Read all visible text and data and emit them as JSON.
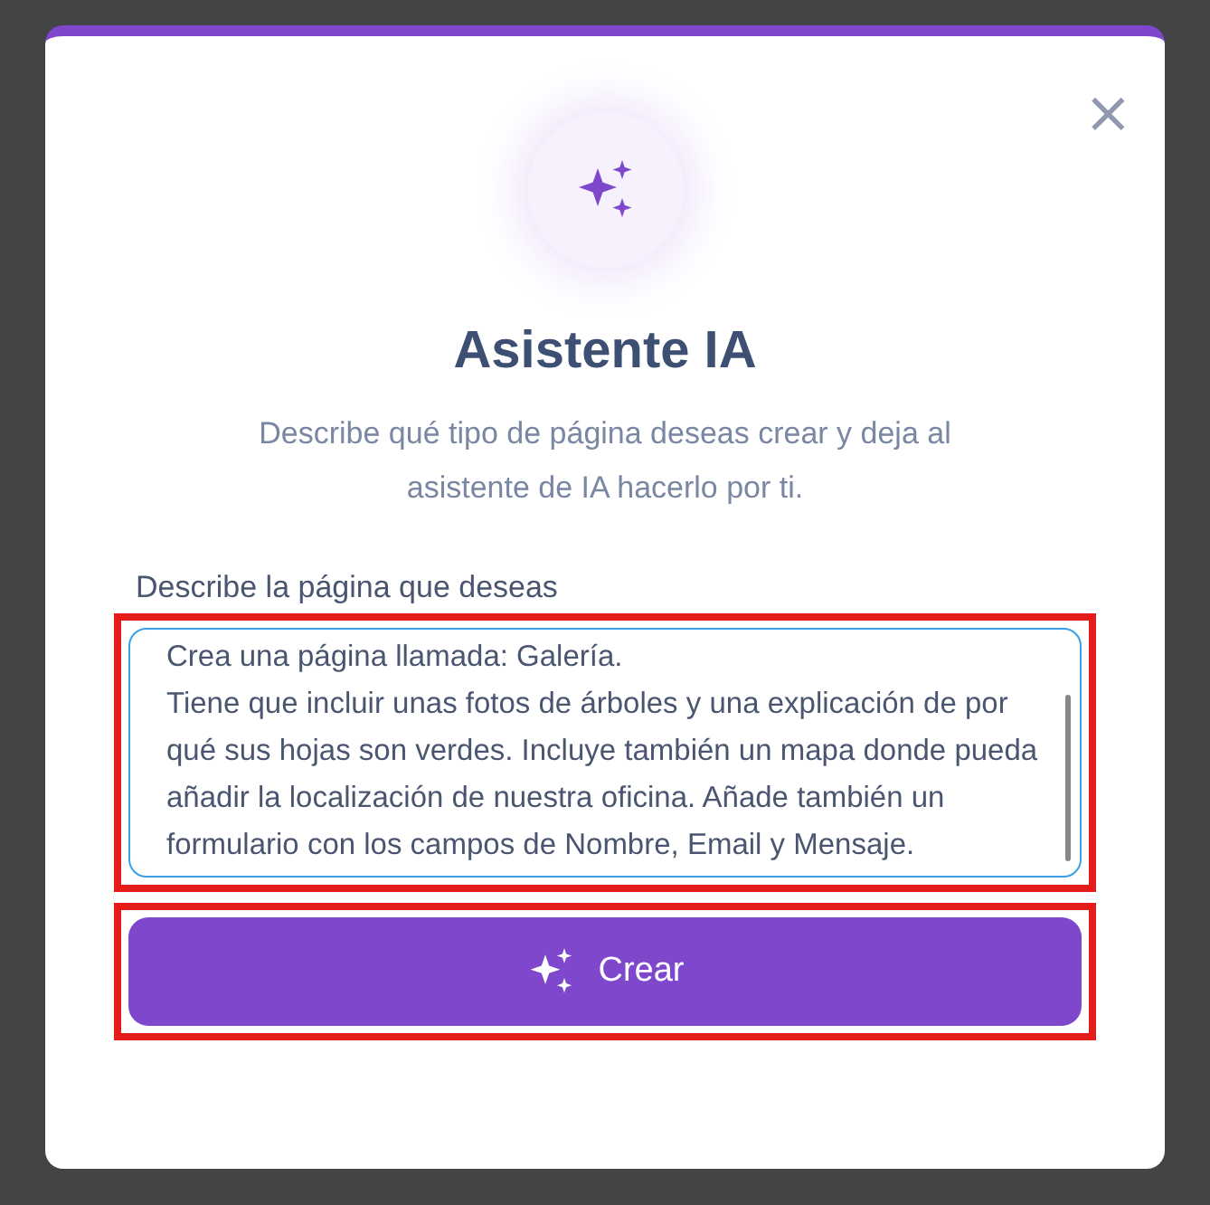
{
  "dialog": {
    "title": "Asistente IA",
    "description": "Describe qué tipo de página deseas crear y deja al asistente de IA hacerlo por ti.",
    "close": "×"
  },
  "field": {
    "label": "Describe la página que deseas",
    "value": "Crea una página llamada: Galería.\nTiene que incluir unas fotos de árboles y una explicación de por qué sus hojas son verdes. Incluye también un mapa donde pueda añadir la localización de nuestra oficina. Añade también un formulario con los campos de Nombre, Email y Mensaje.",
    "highlighted": true
  },
  "button": {
    "label": "Crear",
    "highlighted": true
  }
}
